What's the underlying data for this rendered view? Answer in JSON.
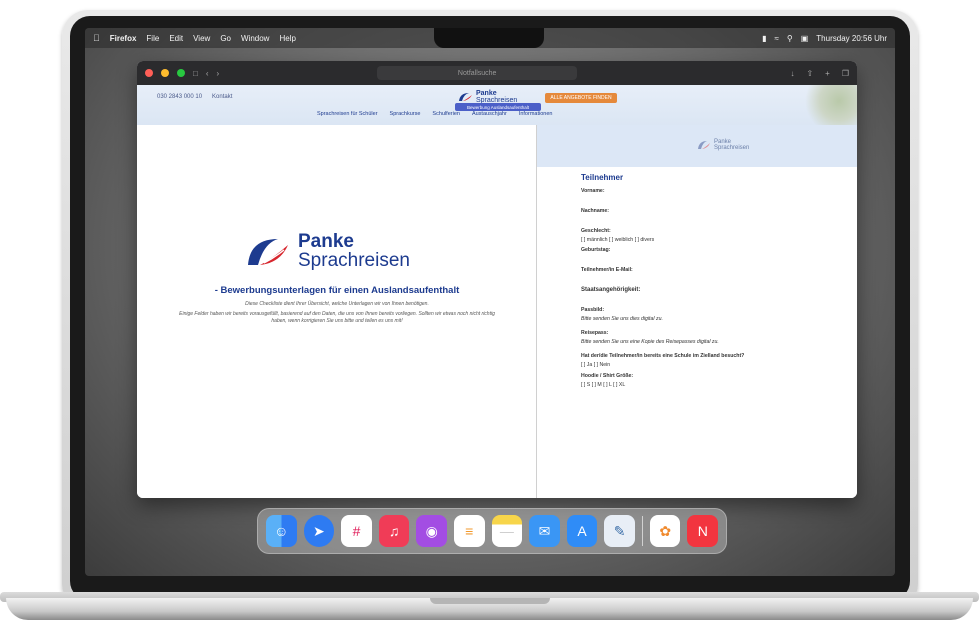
{
  "menubar": {
    "app_name": "Firefox",
    "items": [
      "File",
      "Edit",
      "View",
      "Go",
      "Window",
      "Help"
    ],
    "clock": "Thursday 20:56 Uhr"
  },
  "browser": {
    "url": "Notfallsuche"
  },
  "site": {
    "contact_phone": "030 2843 000 10",
    "contact_label": "Kontakt",
    "logo_line1": "Panke",
    "logo_line2": "Sprachreisen",
    "cta": "ALLE ANGEBOTE FINDEN",
    "nav": [
      "Sprachreisen für Schüler",
      "Sprachkurse",
      "Schulferien",
      "Austauschjahr",
      "Informationen"
    ],
    "tag": "Bewerbung Auslandsaufenthalt"
  },
  "document": {
    "logo_line1": "Panke",
    "logo_line2": "Sprachreisen",
    "title": "- Bewerbungsunterlagen für einen Auslandsaufenthalt",
    "subtitle": "Diese Checkliste dient Ihrer Übersicht, welche Unterlagen wir von Ihnen benötigen.",
    "body": "Einige Felder haben wir bereits vorausgefüllt, basierend auf den Daten, die uns von Ihnen bereits vorliegen. Sollten wir etwas noch nicht richtig haben, wenn korrigieren Sie uns bitte und teilen es uns mit!"
  },
  "form": {
    "logo_line1": "Panke",
    "logo_line2": "Sprachreisen",
    "heading": "Teilnehmer",
    "first_name": "Vorname:",
    "last_name": "Nachname:",
    "gender": "Geschlecht:",
    "gender_options": "[ ] männlich   [ ] weiblich   [ ] divers",
    "birthday": "Geburtstag:",
    "email": "Teilnehmer/in E-Mail:",
    "nationality": "Staatsangehörigkeit:",
    "photo": "Passbild:",
    "photo_hint": "Bitte senden Sie uns dies digital zu.",
    "passport": "Reisepass:",
    "passport_hint": "Bitte senden Sie uns eine Kopie des Reisepasses digital zu.",
    "school_question": "Hat der/die Teilnehmer/in bereits eine Schule im Zielland besucht?",
    "school_options": "[ ] Ja    [ ] Nein",
    "shirt_size": "Hoodie / Shirt Größe:",
    "shirt_options": "[ ] S     [ ] M     [ ] L     [ ] XL"
  },
  "dock": {
    "apps": [
      {
        "icon": "finder-icon",
        "color": "#3b8df0"
      },
      {
        "icon": "safari-icon",
        "color": "#2e7bf2"
      },
      {
        "icon": "slack-icon",
        "color": "#ffffff"
      },
      {
        "icon": "music-icon",
        "color": "#f03c57"
      },
      {
        "icon": "podcasts-icon",
        "color": "#a34de3"
      },
      {
        "icon": "reminders-icon",
        "color": "#ffffff"
      },
      {
        "icon": "notes-icon",
        "color": "#f7d54a"
      },
      {
        "icon": "mail-icon",
        "color": "#3a96f5"
      },
      {
        "icon": "app-store-icon",
        "color": "#2f8cf7"
      },
      {
        "icon": "preview-icon",
        "color": "#e8eef6"
      },
      {
        "icon": "photos-icon",
        "color": "#ffffff"
      },
      {
        "icon": "news-icon",
        "color": "#f2353f"
      }
    ]
  },
  "colors": {
    "brand_blue": "#1d3b8f",
    "cta_orange": "#e5893b",
    "brand_red": "#d7262e"
  }
}
